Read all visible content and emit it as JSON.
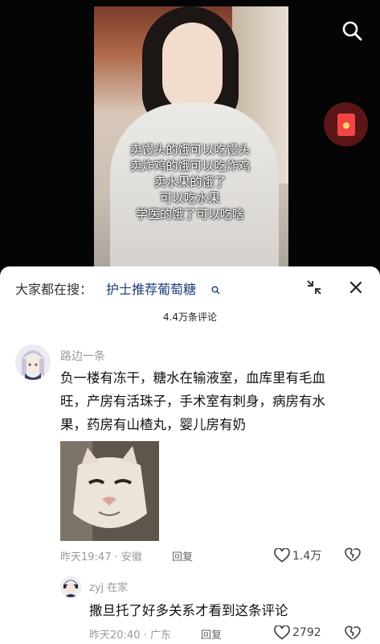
{
  "video": {
    "caption_lines": [
      "卖馒头的饿可以吃馒头",
      "卖炸鸡的饿可以吃炸鸡",
      "卖水果的饿了",
      "可以吃水果",
      "学医的饿了可以吃啥"
    ],
    "icons": [
      "search-icon",
      "red-packet-icon"
    ]
  },
  "search_bar": {
    "prefix": "大家都在搜：",
    "term": "护士推荐葡萄糖"
  },
  "comments_count": "4.4万条评论",
  "comments": [
    {
      "username": "路边一条",
      "text_lines": [
        "负一楼有冻干，糖水在输液室，血库里有毛血",
        "旺，产房有活珠子，手术室有刺身，病房有水",
        "果，药房有山楂丸，婴儿房有奶"
      ],
      "image": "cat-image",
      "time": "昨天19:47",
      "location": "安徽",
      "reply_label": "回复",
      "likes": "1.4万"
    },
    {
      "username": "zyj",
      "tag": "在家",
      "text": "撒旦托了好多关系才看到这条评论",
      "time": "昨天20:40",
      "location": "广东",
      "reply_label": "回复",
      "likes": "2792"
    }
  ],
  "colors": {
    "search_term": "#1d3d7a",
    "meta": "#999999",
    "red_packet": "#f24545"
  }
}
